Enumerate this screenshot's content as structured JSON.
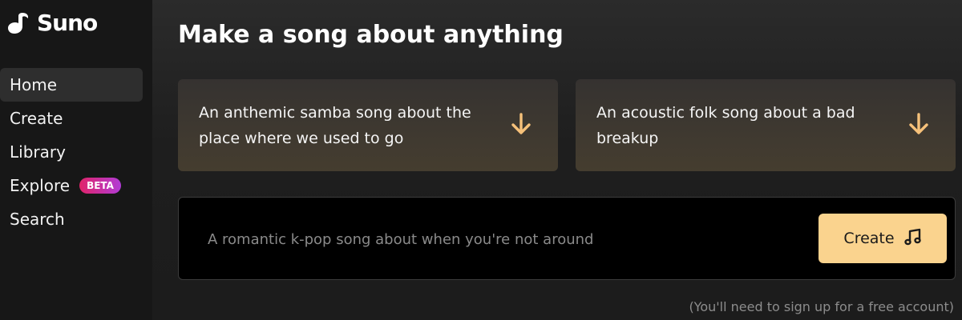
{
  "app": {
    "name": "Suno"
  },
  "sidebar": {
    "items": [
      {
        "label": "Home",
        "active": true
      },
      {
        "label": "Create"
      },
      {
        "label": "Library"
      },
      {
        "label": "Explore",
        "badge": "BETA"
      },
      {
        "label": "Search"
      }
    ]
  },
  "main": {
    "title": "Make a song about anything",
    "suggestions": [
      {
        "text": "An anthemic samba song about the place where we used to go",
        "icon": "arrow-down-icon"
      },
      {
        "text": "An acoustic folk song about a bad breakup",
        "icon": "arrow-down-icon"
      }
    ],
    "prompt": {
      "placeholder": "A romantic k-pop song about when you're not around",
      "value": ""
    },
    "create_button": {
      "label": "Create",
      "icon": "music-note-icon"
    },
    "signup_note": "(You'll need to sign up for a free account)"
  },
  "colors": {
    "accent": "#fad38e",
    "arrow": "#f6c17a",
    "badge_start": "#e0246a",
    "badge_end": "#b13bd6",
    "background": "#1c1c1c"
  }
}
